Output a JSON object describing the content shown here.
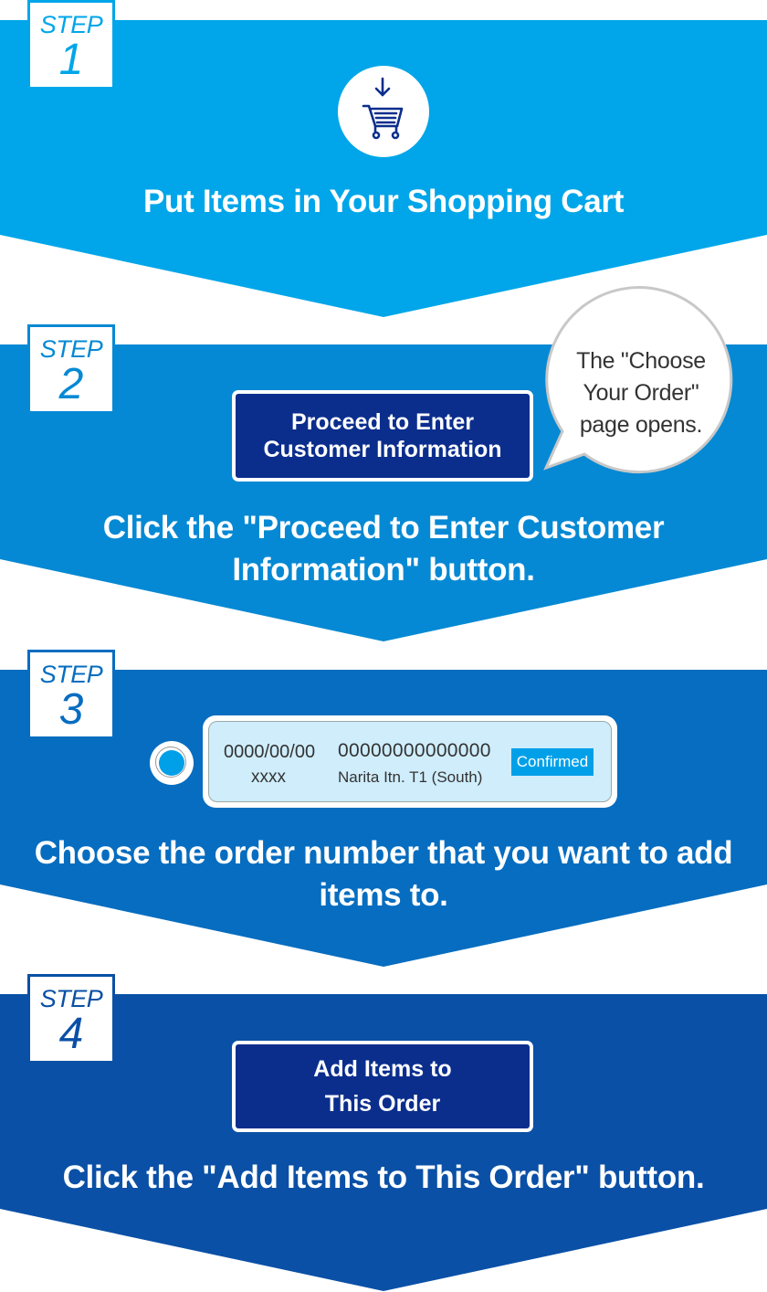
{
  "colors": {
    "step1": "#00A6E9",
    "step2": "#0589D4",
    "step3": "#066DC0",
    "step4": "#0A50A6",
    "button_fill": "#0B2E8D",
    "status_badge": "#00A0E9",
    "order_card_bg": "#CFEDFB"
  },
  "steps": [
    {
      "badge_label": "STEP",
      "number": "1",
      "icon": "shopping-cart-download-icon",
      "caption": "Put Items in Your Shopping Cart"
    },
    {
      "badge_label": "STEP",
      "number": "2",
      "button_lines": [
        "Proceed to Enter",
        "Customer Information"
      ],
      "bubble_lines": [
        "The \"Choose",
        "Your Order\"",
        "page opens."
      ],
      "caption_lines": [
        "Click the \"Proceed to Enter Customer",
        "Information\" button."
      ]
    },
    {
      "badge_label": "STEP",
      "number": "3",
      "order": {
        "date": "0000/00/00",
        "name": "xxxx",
        "order_number": "00000000000000",
        "location": "Narita Itn. T1 (South)",
        "status": "Confirmed",
        "selected": true
      },
      "caption_lines": [
        "Choose the order number that you want to add",
        "items to."
      ]
    },
    {
      "badge_label": "STEP",
      "number": "4",
      "button_lines": [
        "Add Items to",
        "This Order"
      ],
      "caption": "Click the \"Add Items to This Order\" button."
    }
  ]
}
